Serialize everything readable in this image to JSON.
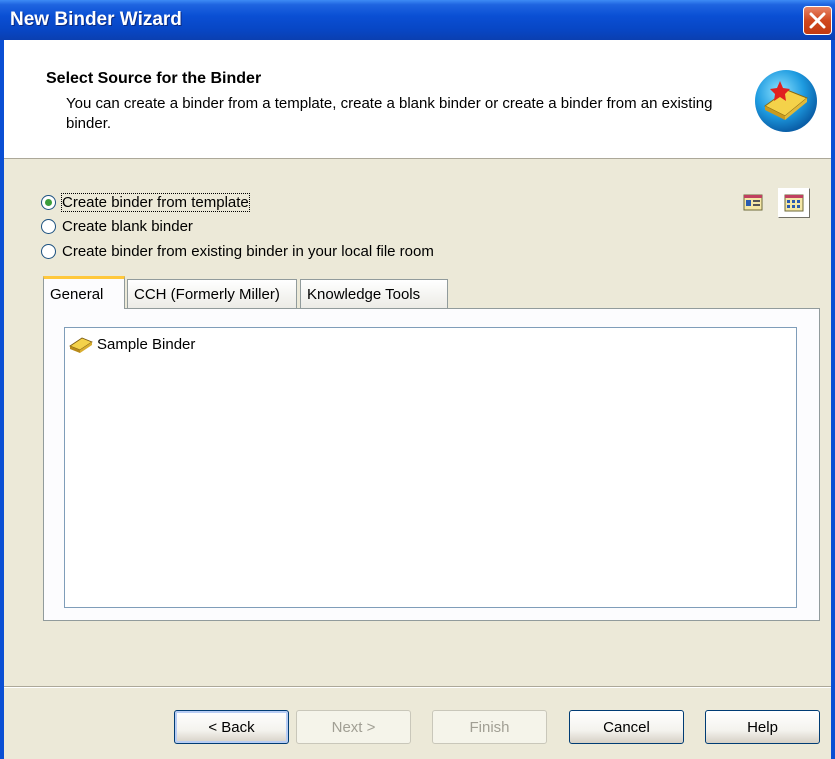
{
  "window": {
    "title": "New Binder Wizard"
  },
  "header": {
    "title": "Select Source for the Binder",
    "description": "You can create a binder from a template, create a blank binder or create a binder from an existing binder."
  },
  "options": [
    {
      "label": "Create binder from template",
      "checked": true
    },
    {
      "label": "Create blank binder",
      "checked": false
    },
    {
      "label": "Create binder from existing binder in your local file room",
      "checked": false
    }
  ],
  "tabs": [
    {
      "label": "General",
      "active": true
    },
    {
      "label": "CCH (Formerly Miller)",
      "active": false
    },
    {
      "label": "Knowledge Tools",
      "active": false
    }
  ],
  "list": {
    "items": [
      {
        "label": "Sample Binder",
        "icon": "binder-icon"
      }
    ]
  },
  "buttons": {
    "back": "< Back",
    "next": "Next >",
    "finish": "Finish",
    "cancel": "Cancel",
    "help": "Help"
  },
  "colors": {
    "titlebar": "#0A4FD4",
    "accent_tab": "#FFC83C",
    "background": "#ECE9D8"
  }
}
